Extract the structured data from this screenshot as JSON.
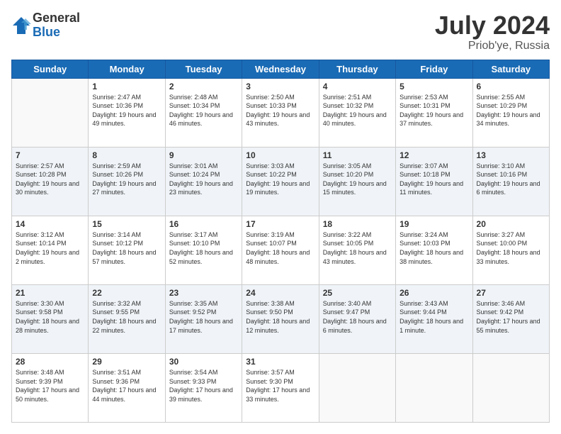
{
  "logo": {
    "general": "General",
    "blue": "Blue"
  },
  "title": {
    "month_year": "July 2024",
    "location": "Priob'ye, Russia"
  },
  "headers": [
    "Sunday",
    "Monday",
    "Tuesday",
    "Wednesday",
    "Thursday",
    "Friday",
    "Saturday"
  ],
  "weeks": [
    [
      {
        "day": "",
        "sunrise": "",
        "sunset": "",
        "daylight": ""
      },
      {
        "day": "1",
        "sunrise": "Sunrise: 2:47 AM",
        "sunset": "Sunset: 10:36 PM",
        "daylight": "Daylight: 19 hours and 49 minutes."
      },
      {
        "day": "2",
        "sunrise": "Sunrise: 2:48 AM",
        "sunset": "Sunset: 10:34 PM",
        "daylight": "Daylight: 19 hours and 46 minutes."
      },
      {
        "day": "3",
        "sunrise": "Sunrise: 2:50 AM",
        "sunset": "Sunset: 10:33 PM",
        "daylight": "Daylight: 19 hours and 43 minutes."
      },
      {
        "day": "4",
        "sunrise": "Sunrise: 2:51 AM",
        "sunset": "Sunset: 10:32 PM",
        "daylight": "Daylight: 19 hours and 40 minutes."
      },
      {
        "day": "5",
        "sunrise": "Sunrise: 2:53 AM",
        "sunset": "Sunset: 10:31 PM",
        "daylight": "Daylight: 19 hours and 37 minutes."
      },
      {
        "day": "6",
        "sunrise": "Sunrise: 2:55 AM",
        "sunset": "Sunset: 10:29 PM",
        "daylight": "Daylight: 19 hours and 34 minutes."
      }
    ],
    [
      {
        "day": "7",
        "sunrise": "Sunrise: 2:57 AM",
        "sunset": "Sunset: 10:28 PM",
        "daylight": "Daylight: 19 hours and 30 minutes."
      },
      {
        "day": "8",
        "sunrise": "Sunrise: 2:59 AM",
        "sunset": "Sunset: 10:26 PM",
        "daylight": "Daylight: 19 hours and 27 minutes."
      },
      {
        "day": "9",
        "sunrise": "Sunrise: 3:01 AM",
        "sunset": "Sunset: 10:24 PM",
        "daylight": "Daylight: 19 hours and 23 minutes."
      },
      {
        "day": "10",
        "sunrise": "Sunrise: 3:03 AM",
        "sunset": "Sunset: 10:22 PM",
        "daylight": "Daylight: 19 hours and 19 minutes."
      },
      {
        "day": "11",
        "sunrise": "Sunrise: 3:05 AM",
        "sunset": "Sunset: 10:20 PM",
        "daylight": "Daylight: 19 hours and 15 minutes."
      },
      {
        "day": "12",
        "sunrise": "Sunrise: 3:07 AM",
        "sunset": "Sunset: 10:18 PM",
        "daylight": "Daylight: 19 hours and 11 minutes."
      },
      {
        "day": "13",
        "sunrise": "Sunrise: 3:10 AM",
        "sunset": "Sunset: 10:16 PM",
        "daylight": "Daylight: 19 hours and 6 minutes."
      }
    ],
    [
      {
        "day": "14",
        "sunrise": "Sunrise: 3:12 AM",
        "sunset": "Sunset: 10:14 PM",
        "daylight": "Daylight: 19 hours and 2 minutes."
      },
      {
        "day": "15",
        "sunrise": "Sunrise: 3:14 AM",
        "sunset": "Sunset: 10:12 PM",
        "daylight": "Daylight: 18 hours and 57 minutes."
      },
      {
        "day": "16",
        "sunrise": "Sunrise: 3:17 AM",
        "sunset": "Sunset: 10:10 PM",
        "daylight": "Daylight: 18 hours and 52 minutes."
      },
      {
        "day": "17",
        "sunrise": "Sunrise: 3:19 AM",
        "sunset": "Sunset: 10:07 PM",
        "daylight": "Daylight: 18 hours and 48 minutes."
      },
      {
        "day": "18",
        "sunrise": "Sunrise: 3:22 AM",
        "sunset": "Sunset: 10:05 PM",
        "daylight": "Daylight: 18 hours and 43 minutes."
      },
      {
        "day": "19",
        "sunrise": "Sunrise: 3:24 AM",
        "sunset": "Sunset: 10:03 PM",
        "daylight": "Daylight: 18 hours and 38 minutes."
      },
      {
        "day": "20",
        "sunrise": "Sunrise: 3:27 AM",
        "sunset": "Sunset: 10:00 PM",
        "daylight": "Daylight: 18 hours and 33 minutes."
      }
    ],
    [
      {
        "day": "21",
        "sunrise": "Sunrise: 3:30 AM",
        "sunset": "Sunset: 9:58 PM",
        "daylight": "Daylight: 18 hours and 28 minutes."
      },
      {
        "day": "22",
        "sunrise": "Sunrise: 3:32 AM",
        "sunset": "Sunset: 9:55 PM",
        "daylight": "Daylight: 18 hours and 22 minutes."
      },
      {
        "day": "23",
        "sunrise": "Sunrise: 3:35 AM",
        "sunset": "Sunset: 9:52 PM",
        "daylight": "Daylight: 18 hours and 17 minutes."
      },
      {
        "day": "24",
        "sunrise": "Sunrise: 3:38 AM",
        "sunset": "Sunset: 9:50 PM",
        "daylight": "Daylight: 18 hours and 12 minutes."
      },
      {
        "day": "25",
        "sunrise": "Sunrise: 3:40 AM",
        "sunset": "Sunset: 9:47 PM",
        "daylight": "Daylight: 18 hours and 6 minutes."
      },
      {
        "day": "26",
        "sunrise": "Sunrise: 3:43 AM",
        "sunset": "Sunset: 9:44 PM",
        "daylight": "Daylight: 18 hours and 1 minute."
      },
      {
        "day": "27",
        "sunrise": "Sunrise: 3:46 AM",
        "sunset": "Sunset: 9:42 PM",
        "daylight": "Daylight: 17 hours and 55 minutes."
      }
    ],
    [
      {
        "day": "28",
        "sunrise": "Sunrise: 3:48 AM",
        "sunset": "Sunset: 9:39 PM",
        "daylight": "Daylight: 17 hours and 50 minutes."
      },
      {
        "day": "29",
        "sunrise": "Sunrise: 3:51 AM",
        "sunset": "Sunset: 9:36 PM",
        "daylight": "Daylight: 17 hours and 44 minutes."
      },
      {
        "day": "30",
        "sunrise": "Sunrise: 3:54 AM",
        "sunset": "Sunset: 9:33 PM",
        "daylight": "Daylight: 17 hours and 39 minutes."
      },
      {
        "day": "31",
        "sunrise": "Sunrise: 3:57 AM",
        "sunset": "Sunset: 9:30 PM",
        "daylight": "Daylight: 17 hours and 33 minutes."
      },
      {
        "day": "",
        "sunrise": "",
        "sunset": "",
        "daylight": ""
      },
      {
        "day": "",
        "sunrise": "",
        "sunset": "",
        "daylight": ""
      },
      {
        "day": "",
        "sunrise": "",
        "sunset": "",
        "daylight": ""
      }
    ]
  ]
}
